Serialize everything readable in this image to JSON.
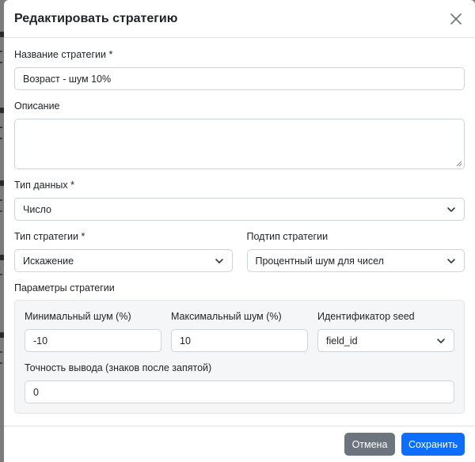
{
  "modal": {
    "title": "Редактировать стратегию"
  },
  "form": {
    "name_label": "Название стратегии *",
    "name_value": "Возраст - шум 10%",
    "description_label": "Описание",
    "description_value": "",
    "data_type_label": "Тип данных *",
    "data_type_value": "Число",
    "strategy_type_label": "Тип стратегии *",
    "strategy_type_value": "Искажение",
    "strategy_subtype_label": "Подтип стратегии",
    "strategy_subtype_value": "Процентный шум для чисел",
    "params_label": "Параметры стратегии"
  },
  "params": {
    "min_noise_label": "Минимальный шум (%)",
    "min_noise_value": "-10",
    "max_noise_label": "Максимальный шум (%)",
    "max_noise_value": "10",
    "seed_label": "Идентификатор seed",
    "seed_value": "field_id",
    "precision_label": "Точность вывода (знаков после запятой)",
    "precision_value": "0"
  },
  "footer": {
    "cancel_label": "Отмена",
    "save_label": "Сохранить"
  },
  "colors": {
    "primary": "#0d6efd",
    "secondary": "#6c757d"
  },
  "icons": {
    "close": "close-icon",
    "chevron": "chevron-down-icon"
  }
}
